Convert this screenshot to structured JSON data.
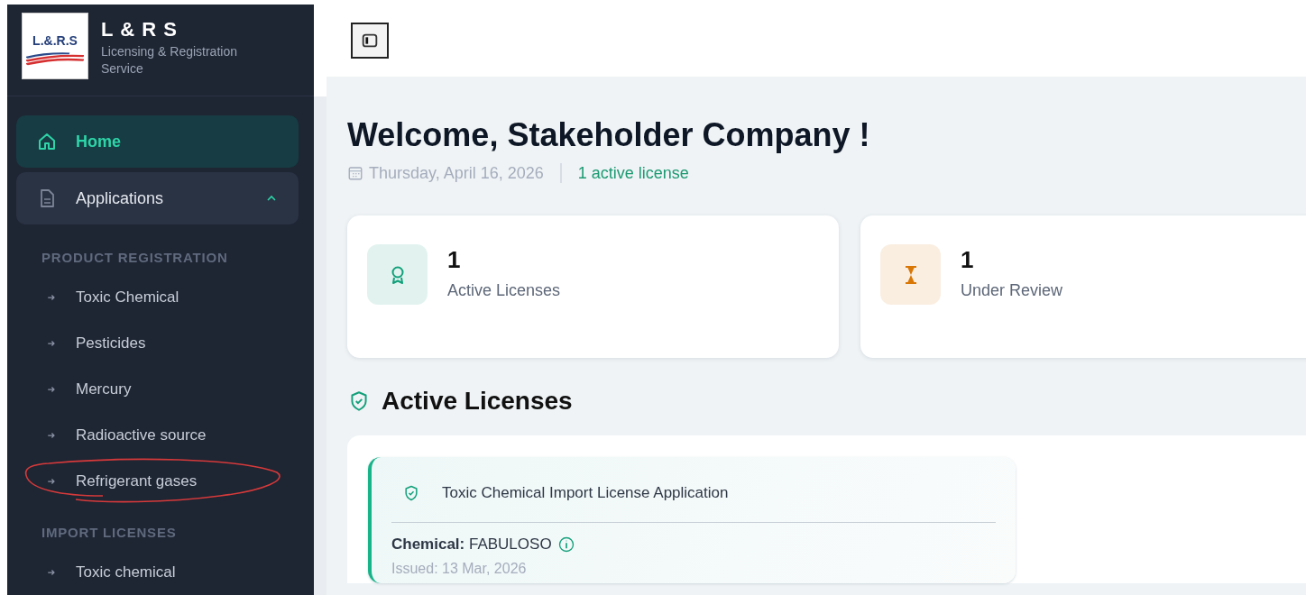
{
  "brand": {
    "title": "L & R S",
    "subtitle": "Licensing & Registration Service",
    "logo_text": "L.&.R.S"
  },
  "sidebar": {
    "items": [
      {
        "label": "Home",
        "kind": "home",
        "selected": true
      },
      {
        "label": "Applications",
        "kind": "document",
        "selected": false,
        "expanded": true
      }
    ],
    "sections": [
      {
        "title": "PRODUCT REGISTRATION",
        "items": [
          {
            "label": "Toxic Chemical",
            "circled": false
          },
          {
            "label": "Pesticides",
            "circled": false
          },
          {
            "label": "Mercury",
            "circled": false
          },
          {
            "label": "Radioactive source",
            "circled": false
          },
          {
            "label": "Refrigerant gases",
            "circled": true
          }
        ]
      },
      {
        "title": "IMPORT LICENSES",
        "items": [
          {
            "label": "Toxic chemical",
            "circled": false
          }
        ]
      }
    ]
  },
  "welcome": {
    "title": "Welcome, Stakeholder Company !",
    "date": "Thursday, April 16, 2026",
    "active_note": "1 active license"
  },
  "stats": [
    {
      "value": "1",
      "label": "Active Licenses",
      "kind": "award",
      "color": "#12a07a"
    },
    {
      "value": "1",
      "label": "Under Review",
      "kind": "hourglass",
      "color": "#d97706"
    }
  ],
  "licenses": {
    "heading": "Active Licenses",
    "cards": [
      {
        "title": "Toxic Chemical Import License Application",
        "field_label": "Chemical:",
        "field_value": "FABULOSO",
        "issued": "Issued: 13 Mar, 2026"
      }
    ]
  }
}
